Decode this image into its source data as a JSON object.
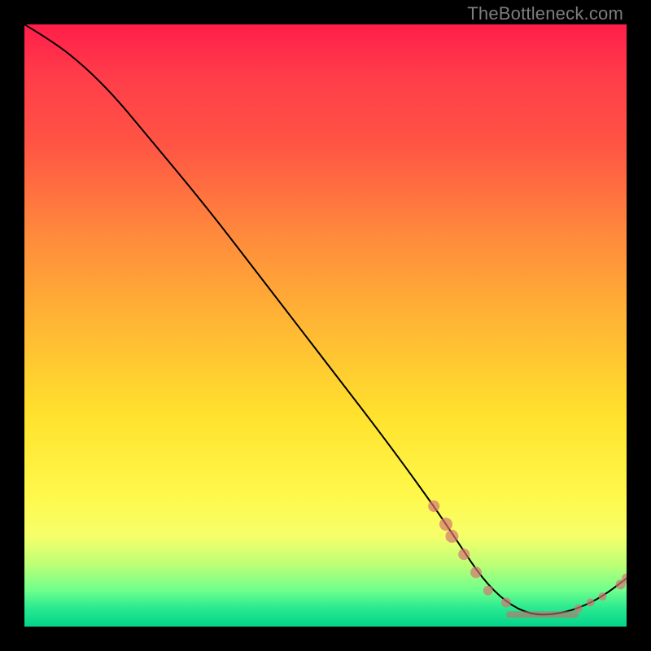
{
  "watermark": "TheBottleneck.com",
  "chart_data": {
    "type": "line",
    "title": "",
    "xlabel": "",
    "ylabel": "",
    "xlim": [
      0,
      100
    ],
    "ylim": [
      0,
      100
    ],
    "curve": [
      {
        "x": 0,
        "y": 100
      },
      {
        "x": 5,
        "y": 97
      },
      {
        "x": 10,
        "y": 93
      },
      {
        "x": 15,
        "y": 88
      },
      {
        "x": 20,
        "y": 82
      },
      {
        "x": 30,
        "y": 70
      },
      {
        "x": 40,
        "y": 57
      },
      {
        "x": 50,
        "y": 44
      },
      {
        "x": 60,
        "y": 31
      },
      {
        "x": 68,
        "y": 20
      },
      {
        "x": 72,
        "y": 14
      },
      {
        "x": 76,
        "y": 8
      },
      {
        "x": 80,
        "y": 4
      },
      {
        "x": 84,
        "y": 2
      },
      {
        "x": 88,
        "y": 2
      },
      {
        "x": 92,
        "y": 3
      },
      {
        "x": 96,
        "y": 5
      },
      {
        "x": 100,
        "y": 8
      }
    ],
    "highlighted_points": [
      {
        "x": 68,
        "y": 20,
        "r": 7
      },
      {
        "x": 70,
        "y": 17,
        "r": 8
      },
      {
        "x": 71,
        "y": 15,
        "r": 8
      },
      {
        "x": 73,
        "y": 12,
        "r": 7
      },
      {
        "x": 75,
        "y": 9,
        "r": 7
      },
      {
        "x": 77,
        "y": 6,
        "r": 6
      },
      {
        "x": 80,
        "y": 4,
        "r": 6
      },
      {
        "x": 92,
        "y": 3,
        "r": 5
      },
      {
        "x": 94,
        "y": 4,
        "r": 5
      },
      {
        "x": 96,
        "y": 5,
        "r": 5
      },
      {
        "x": 99,
        "y": 7,
        "r": 6
      },
      {
        "x": 100,
        "y": 8,
        "r": 6
      }
    ],
    "valley_band": {
      "x_from": 80,
      "x_to": 92,
      "y": 2
    }
  },
  "colors": {
    "curve": "#000000",
    "marker": "#d57272"
  }
}
